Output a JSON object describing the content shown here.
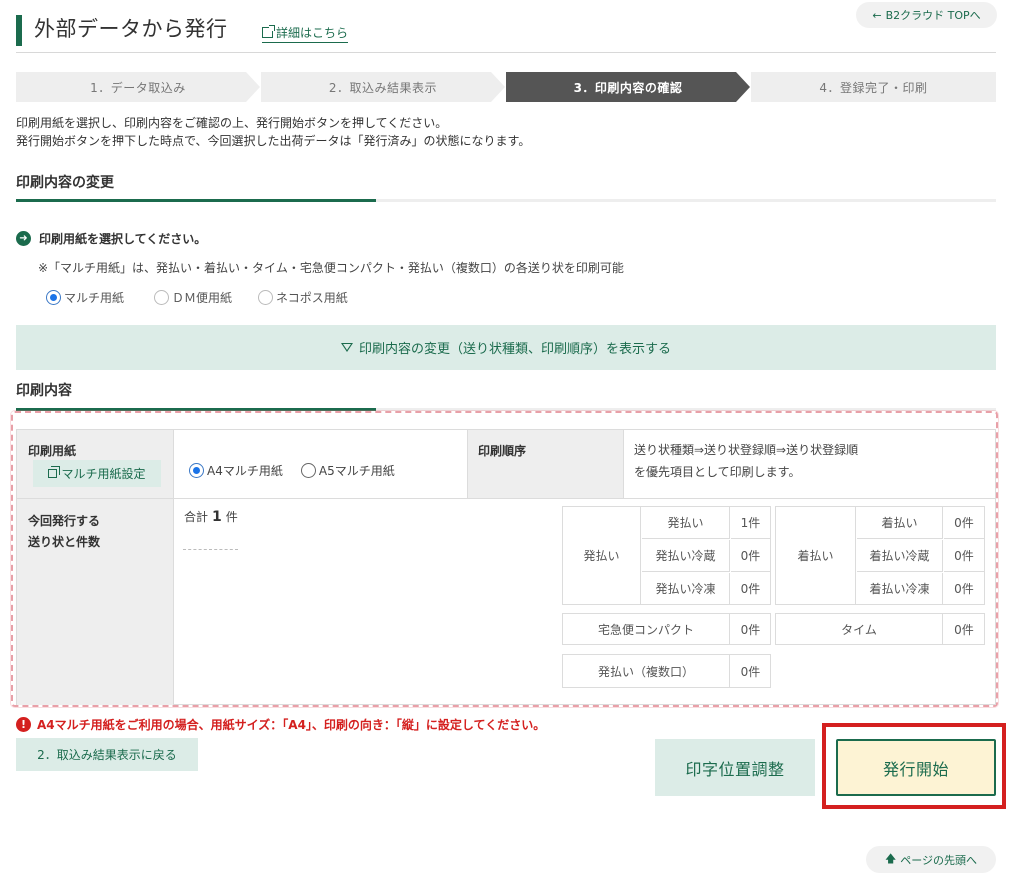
{
  "header": {
    "title": "外部データから発行",
    "detail_link": "詳細はこちら",
    "top_button": "B2クラウド TOPへ"
  },
  "steps": [
    {
      "label": "1．データ取込み",
      "active": false
    },
    {
      "label": "2．取込み結果表示",
      "active": false
    },
    {
      "label": "3．印刷内容の確認",
      "active": true
    },
    {
      "label": "4．登録完了・印刷",
      "active": false
    }
  ],
  "description": {
    "line1": "印刷用紙を選択し、印刷内容をご確認の上、発行開始ボタンを押してください。",
    "line2": "発行開始ボタンを押下した時点で、今回選択した出荷データは「発行済み」の状態になります。"
  },
  "change_section": {
    "title": "印刷内容の変更",
    "instruction": "印刷用紙を選択してください。",
    "note": "※「マルチ用紙」は、発払い・着払い・タイム・宅急便コンパクト・発払い（複数口）の各送り状を印刷可能",
    "paper_options": [
      {
        "label": "マルチ用紙",
        "selected": true
      },
      {
        "label": "ＤＭ便用紙",
        "selected": false
      },
      {
        "label": "ネコポス用紙",
        "selected": false
      }
    ],
    "expand_label": "印刷内容の変更（送り状種類、印刷順序）を表示する"
  },
  "content_section": {
    "title": "印刷内容",
    "paper_header": "印刷用紙",
    "multi_setting_button": "マルチ用紙設定",
    "paper_sizes": [
      {
        "label": "A4マルチ用紙",
        "selected": true
      },
      {
        "label": "A5マルチ用紙",
        "selected": false
      }
    ],
    "order_header": "印刷順序",
    "order_line1": "送り状種類⇒送り状登録順⇒送り状登録順",
    "order_line2": "を優先項目として印刷します。",
    "count_header_line1": "今回発行する",
    "count_header_line2": "送り状と件数",
    "total_label": "合計",
    "total_count": "1",
    "total_unit": "件",
    "prepaid": {
      "group": "発払い",
      "rows": [
        {
          "label": "発払い",
          "count": "1件"
        },
        {
          "label": "発払い冷蔵",
          "count": "0件"
        },
        {
          "label": "発払い冷凍",
          "count": "0件"
        }
      ]
    },
    "collect": {
      "group": "着払い",
      "rows": [
        {
          "label": "着払い",
          "count": "0件"
        },
        {
          "label": "着払い冷蔵",
          "count": "0件"
        },
        {
          "label": "着払い冷凍",
          "count": "0件"
        }
      ]
    },
    "compact": {
      "label": "宅急便コンパクト",
      "count": "0件"
    },
    "time": {
      "label": "タイム",
      "count": "0件"
    },
    "multi": {
      "label": "発払い（複数口）",
      "count": "0件"
    }
  },
  "warning": "A4マルチ用紙をご利用の場合、用紙サイズ：「A4」、印刷の向き：「縦」に設定してください。",
  "buttons": {
    "back": "2．取込み結果表示に戻る",
    "print_position": "印字位置調整",
    "start": "発行開始",
    "page_top": "ページの先頭へ"
  },
  "colors": {
    "brand_green": "#1b6b4d",
    "light_green": "#dcece7",
    "warning_red": "#d4201f",
    "start_bg": "#fdf3d4"
  }
}
